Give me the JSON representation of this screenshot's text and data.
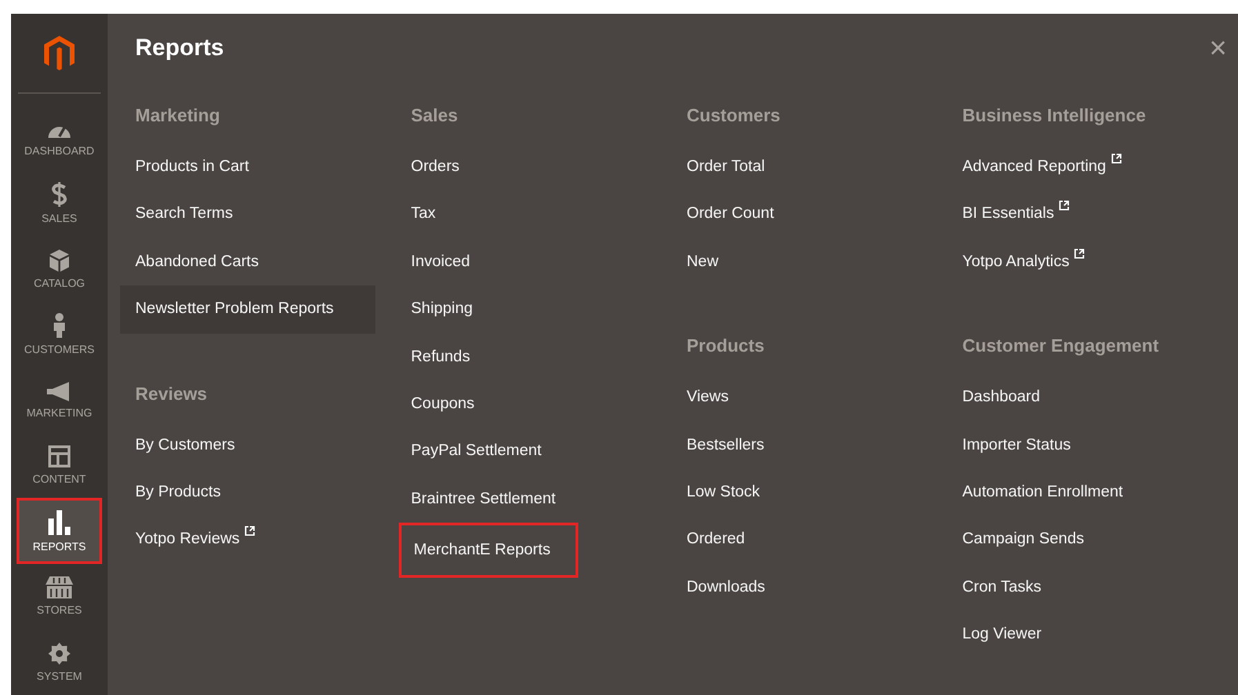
{
  "sidebar": {
    "items": [
      {
        "label": "DASHBOARD",
        "selected": false,
        "outlined": false
      },
      {
        "label": "SALES",
        "selected": false,
        "outlined": false
      },
      {
        "label": "CATALOG",
        "selected": false,
        "outlined": false
      },
      {
        "label": "CUSTOMERS",
        "selected": false,
        "outlined": false
      },
      {
        "label": "MARKETING",
        "selected": false,
        "outlined": false
      },
      {
        "label": "CONTENT",
        "selected": false,
        "outlined": false
      },
      {
        "label": "REPORTS",
        "selected": true,
        "outlined": true
      },
      {
        "label": "STORES",
        "selected": false,
        "outlined": false
      },
      {
        "label": "SYSTEM",
        "selected": false,
        "outlined": false
      }
    ]
  },
  "panel": {
    "title": "Reports",
    "close": "×"
  },
  "columns": [
    {
      "sections": [
        {
          "heading": "Marketing",
          "items": [
            {
              "label": "Products in Cart",
              "external": false,
              "hovered": false,
              "outlined": false
            },
            {
              "label": "Search Terms",
              "external": false,
              "hovered": false,
              "outlined": false
            },
            {
              "label": "Abandoned Carts",
              "external": false,
              "hovered": false,
              "outlined": false
            },
            {
              "label": "Newsletter Problem Reports",
              "external": false,
              "hovered": true,
              "outlined": false
            }
          ]
        },
        {
          "heading": "Reviews",
          "items": [
            {
              "label": "By Customers",
              "external": false,
              "hovered": false,
              "outlined": false
            },
            {
              "label": "By Products",
              "external": false,
              "hovered": false,
              "outlined": false
            },
            {
              "label": "Yotpo Reviews",
              "external": true,
              "hovered": false,
              "outlined": false
            }
          ]
        }
      ]
    },
    {
      "sections": [
        {
          "heading": "Sales",
          "items": [
            {
              "label": "Orders",
              "external": false,
              "hovered": false,
              "outlined": false
            },
            {
              "label": "Tax",
              "external": false,
              "hovered": false,
              "outlined": false
            },
            {
              "label": "Invoiced",
              "external": false,
              "hovered": false,
              "outlined": false
            },
            {
              "label": "Shipping",
              "external": false,
              "hovered": false,
              "outlined": false
            },
            {
              "label": "Refunds",
              "external": false,
              "hovered": false,
              "outlined": false
            },
            {
              "label": "Coupons",
              "external": false,
              "hovered": false,
              "outlined": false
            },
            {
              "label": "PayPal Settlement",
              "external": false,
              "hovered": false,
              "outlined": false
            },
            {
              "label": "Braintree Settlement",
              "external": false,
              "hovered": false,
              "outlined": false
            },
            {
              "label": "MerchantE Reports",
              "external": false,
              "hovered": false,
              "outlined": true
            }
          ]
        }
      ]
    },
    {
      "sections": [
        {
          "heading": "Customers",
          "items": [
            {
              "label": "Order Total",
              "external": false,
              "hovered": false,
              "outlined": false
            },
            {
              "label": "Order Count",
              "external": false,
              "hovered": false,
              "outlined": false
            },
            {
              "label": "New",
              "external": false,
              "hovered": false,
              "outlined": false
            }
          ]
        },
        {
          "heading": "Products",
          "items": [
            {
              "label": "Views",
              "external": false,
              "hovered": false,
              "outlined": false
            },
            {
              "label": "Bestsellers",
              "external": false,
              "hovered": false,
              "outlined": false
            },
            {
              "label": "Low Stock",
              "external": false,
              "hovered": false,
              "outlined": false
            },
            {
              "label": "Ordered",
              "external": false,
              "hovered": false,
              "outlined": false
            },
            {
              "label": "Downloads",
              "external": false,
              "hovered": false,
              "outlined": false
            }
          ]
        }
      ]
    },
    {
      "sections": [
        {
          "heading": "Business Intelligence",
          "items": [
            {
              "label": "Advanced Reporting",
              "external": true,
              "hovered": false,
              "outlined": false
            },
            {
              "label": "BI Essentials",
              "external": true,
              "hovered": false,
              "outlined": false
            },
            {
              "label": "Yotpo Analytics",
              "external": true,
              "hovered": false,
              "outlined": false
            }
          ]
        },
        {
          "heading": "Customer Engagement",
          "items": [
            {
              "label": "Dashboard",
              "external": false,
              "hovered": false,
              "outlined": false
            },
            {
              "label": "Importer Status",
              "external": false,
              "hovered": false,
              "outlined": false
            },
            {
              "label": "Automation Enrollment",
              "external": false,
              "hovered": false,
              "outlined": false
            },
            {
              "label": "Campaign Sends",
              "external": false,
              "hovered": false,
              "outlined": false
            },
            {
              "label": "Cron Tasks",
              "external": false,
              "hovered": false,
              "outlined": false
            },
            {
              "label": "Log Viewer",
              "external": false,
              "hovered": false,
              "outlined": false
            }
          ]
        }
      ]
    }
  ]
}
